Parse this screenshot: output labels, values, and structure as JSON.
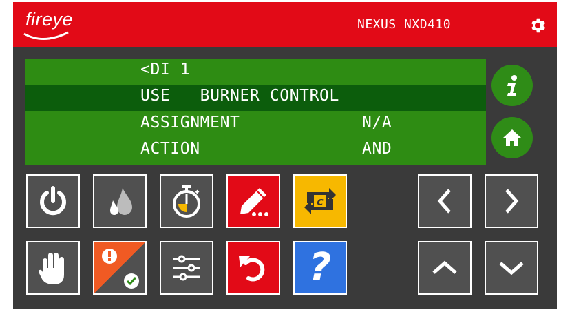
{
  "header": {
    "logo_text": "fireye",
    "model": "NEXUS NXD410",
    "bg_color": "#e20a17",
    "settings_icon": "gear-icon"
  },
  "lcd": {
    "bg_color": "#2e8c13",
    "highlight_color": "#0c5d0c",
    "rows": [
      {
        "label": "<DI 1",
        "value": ""
      },
      {
        "label": "USE   BURNER CONTROL",
        "value": ""
      },
      {
        "label": "ASSIGNMENT",
        "value": "N/A"
      },
      {
        "label": "ACTION",
        "value": "AND"
      }
    ],
    "selected_row": 1
  },
  "side_buttons": {
    "info_icon": "info-icon",
    "home_icon": "home-icon"
  },
  "toolbar": {
    "row1": [
      "power-icon",
      "flame-icon",
      "timer-icon",
      "edit-icon",
      "swap-icon"
    ],
    "row2": [
      "hand-stop-icon",
      "alarm-acknowledge-icon",
      "sliders-icon",
      "undo-icon",
      "help-icon"
    ],
    "help_label": "?",
    "swap_label": "c"
  },
  "nav": {
    "left": "chevron-left-icon",
    "right": "chevron-right-icon",
    "up": "chevron-up-icon",
    "down": "chevron-down-icon"
  }
}
